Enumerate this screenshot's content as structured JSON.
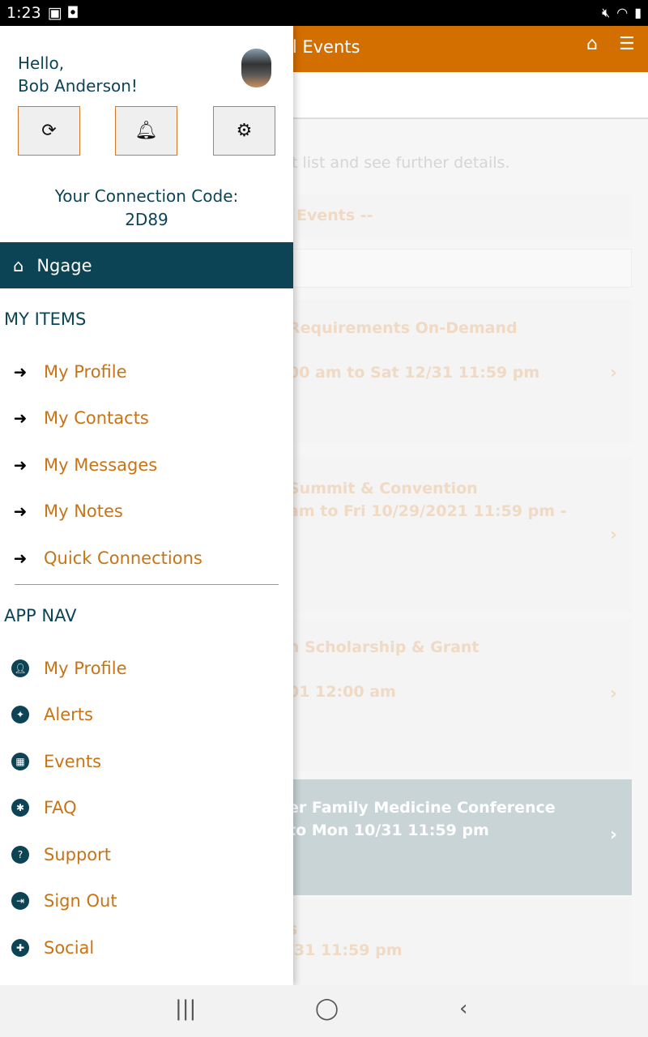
{
  "status_bar": {
    "time": "1:23",
    "icons": [
      "image-icon",
      "app-icon",
      "mute-icon",
      "wifi-icon",
      "battery-icon"
    ]
  },
  "background": {
    "title": "ll Events",
    "hint": "t list and see further details.",
    "filter": "Events --",
    "events": [
      {
        "line1": "Requirements On-Demand",
        "line2": "00 am to Sat 12/31 11:59 pm"
      },
      {
        "line1": "Summit & Convention",
        "line2": "am to Fri 10/29/2021 11:59 pm -"
      },
      {
        "line1": "n Scholarship & Grant",
        "line2": "01 12:00 am"
      },
      {
        "line1": "er Family Medicine Conference",
        "line2": "to Mon 10/31 11:59 pm"
      },
      {
        "line1": "s",
        "line2": "/31 11:59 pm"
      }
    ]
  },
  "drawer": {
    "greeting": "Hello,",
    "name": "Bob Anderson!",
    "connection_label": "Your Connection Code:",
    "connection_code": "2D89",
    "ngage": "Ngage",
    "my_items_heading": "MY ITEMS",
    "my_items": [
      "My Profile",
      "My Contacts",
      "My Messages",
      "My Notes",
      "Quick Connections"
    ],
    "app_nav_heading": "APP NAV",
    "app_nav": [
      "My Profile",
      "Alerts",
      "Events",
      "FAQ",
      "Support",
      "Sign Out",
      "Social"
    ]
  },
  "colors": {
    "brand": "#d36e00",
    "primary": "#0c4455",
    "link": "#c87416"
  }
}
